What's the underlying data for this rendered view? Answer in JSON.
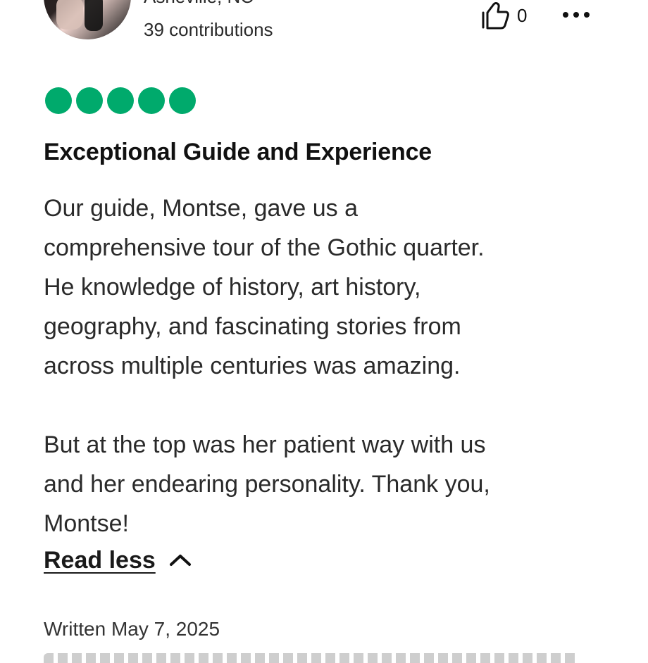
{
  "reviewer": {
    "location": "Asheville, NC",
    "contributions": "39 contributions"
  },
  "actions": {
    "helpful_count": "0",
    "icons": {
      "helpful": "thumbs-up-icon",
      "more": "more-options-icon"
    }
  },
  "review": {
    "rating": {
      "value": 5,
      "max": 5,
      "color": "#00aa6c"
    },
    "title": "Exceptional Guide and Experience",
    "body_paragraphs": [
      "Our guide, Montse, gave us a\ncomprehensive tour of the Gothic quarter.\nHe knowledge of history, art history,\ngeography, and fascinating stories from\nacross multiple centuries was amazing.",
      "But at the top was her patient way with us\nand her endearing personality. Thank you,\nMontse!"
    ],
    "read_less_label": "Read less",
    "written_date": "Written May 7, 2025"
  }
}
